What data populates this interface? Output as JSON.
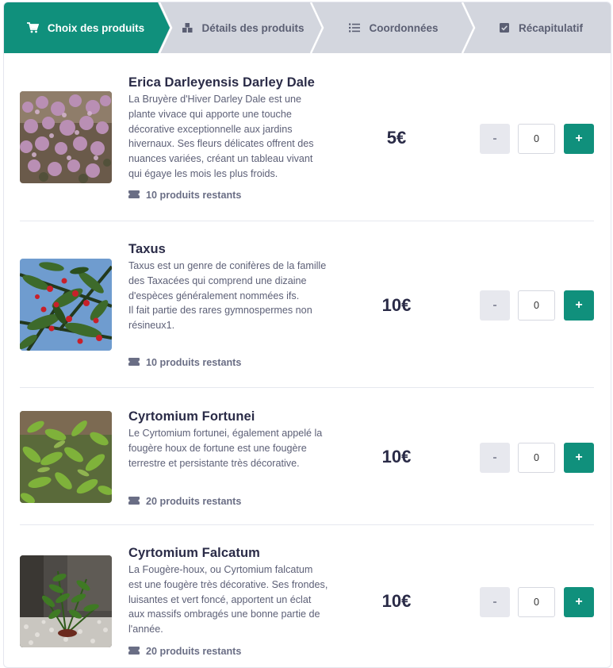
{
  "colors": {
    "accent": "#10907c",
    "step_inactive_bg": "#d3d6de",
    "text_dark": "#2a2b47",
    "text_muted": "#5d6077"
  },
  "stepper": {
    "steps": [
      {
        "label": "Choix des produits",
        "icon": "cart-icon",
        "active": true
      },
      {
        "label": "Détails des produits",
        "icon": "boxes-icon",
        "active": false
      },
      {
        "label": "Coordonnées",
        "icon": "list-icon",
        "active": false
      },
      {
        "label": "Récapitulatif",
        "icon": "checkbox-icon",
        "active": false
      }
    ]
  },
  "products": [
    {
      "name": "Erica Darleyensis Darley Dale",
      "description": "La Bruyère d'Hiver Darley Dale est une plante vivace qui apporte une touche décorative exceptionnelle aux jardins hivernaux. Ses fleurs délicates offrent des nuances variées, créant un tableau vivant qui égaye les mois les plus froids.",
      "stock": "10 produits restants",
      "price": "5€",
      "quantity": "0",
      "minus_label": "-",
      "plus_label": "+"
    },
    {
      "name": "Taxus",
      "description": "Taxus est un genre de conifères de la famille des Taxacées qui comprend une dizaine d'espèces généralement nommées ifs.\nIl fait partie des rares gymnospermes non résineux1.",
      "stock": "10 produits restants",
      "price": "10€",
      "quantity": "0",
      "minus_label": "-",
      "plus_label": "+"
    },
    {
      "name": "Cyrtomium Fortunei",
      "description": "Le Cyrtomium fortunei, également appelé la fougère houx de fortune est une fougère terrestre et persistante très décorative.",
      "stock": "20 produits restants",
      "price": "10€",
      "quantity": "0",
      "minus_label": "-",
      "plus_label": "+"
    },
    {
      "name": "Cyrtomium Falcatum",
      "description": "La Fougère-houx, ou Cyrtomium falcatum est une fougère très décorative. Ses frondes, luisantes et vert foncé, apportent un éclat aux massifs ombragés une bonne partie de l'année.",
      "stock": "20 produits restants",
      "price": "10€",
      "quantity": "0",
      "minus_label": "-",
      "plus_label": "+"
    }
  ]
}
